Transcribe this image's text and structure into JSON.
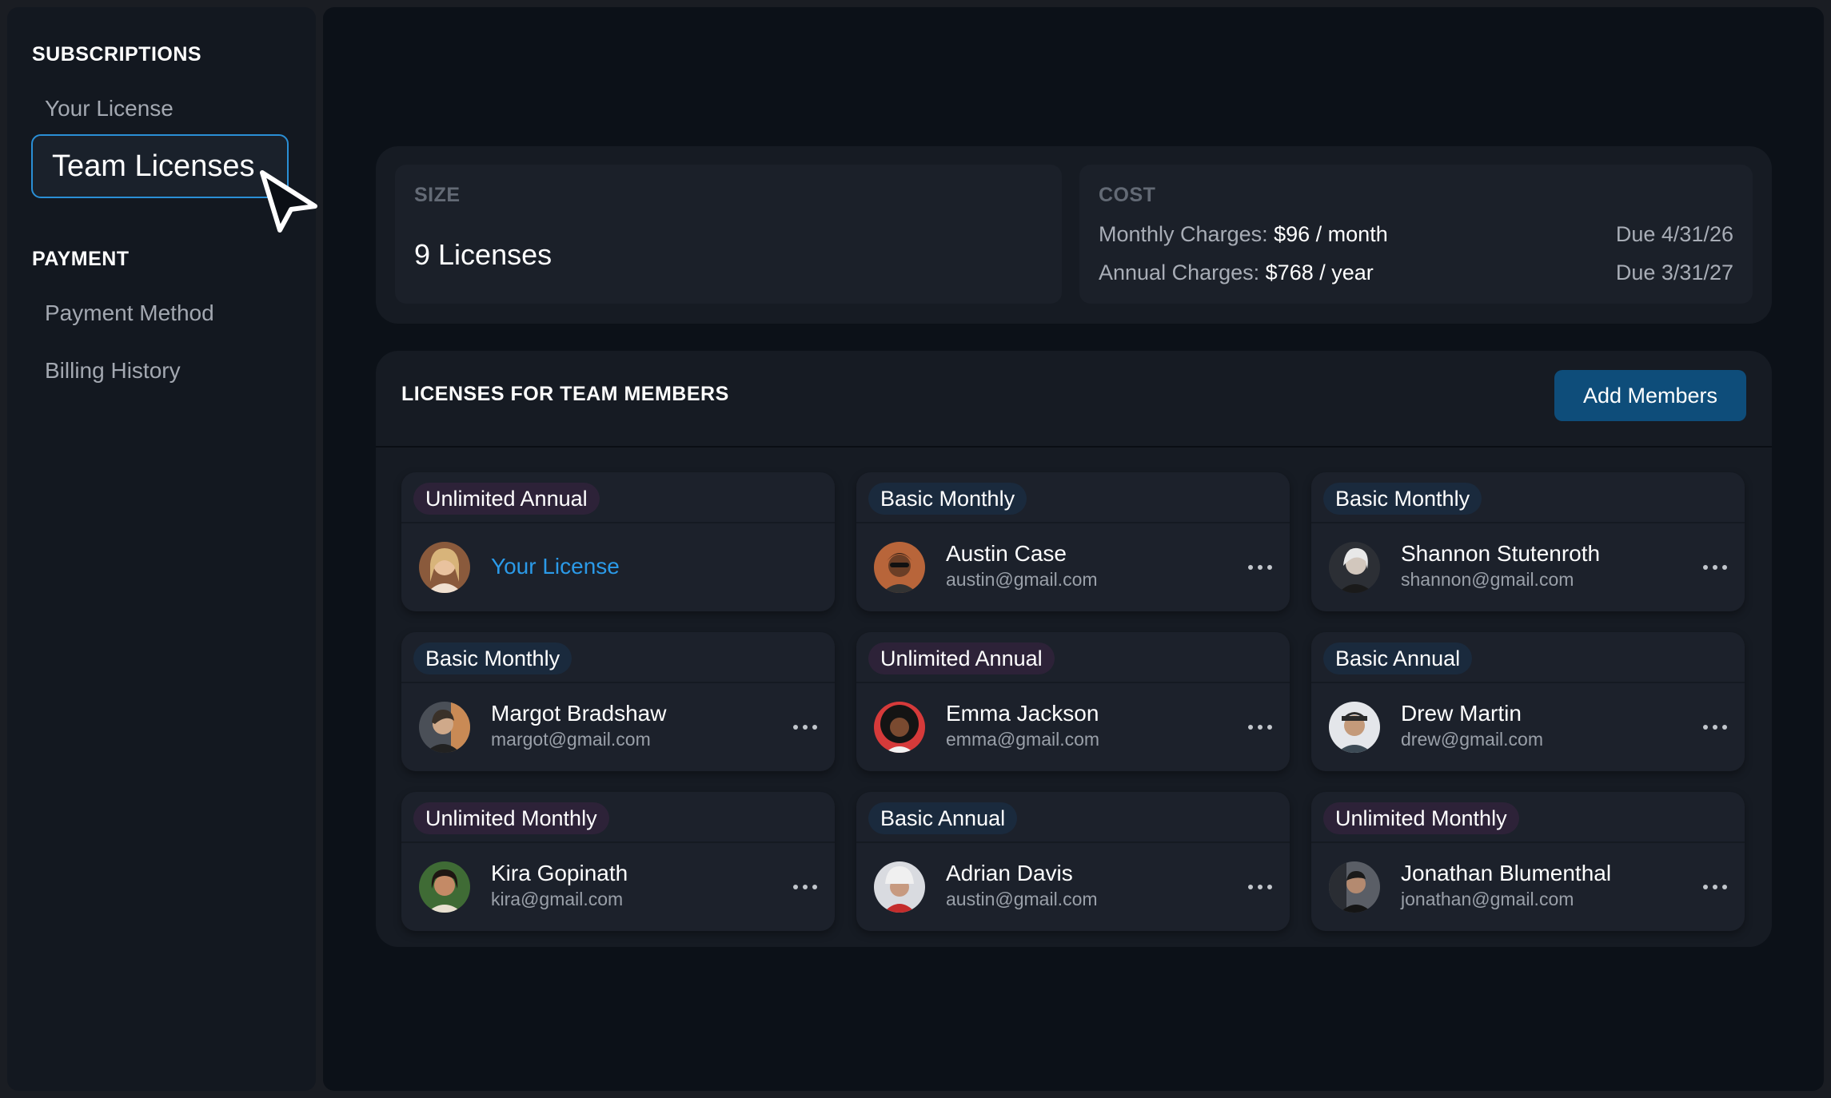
{
  "sidebar": {
    "subscriptions_heading": "SUBSCRIPTIONS",
    "your_license": "Your License",
    "team_licenses": "Team Licenses",
    "payment_heading": "PAYMENT",
    "payment_method": "Payment Method",
    "billing_history": "Billing History"
  },
  "summary": {
    "size_label": "SIZE",
    "size_value": "9 Licenses",
    "cost_label": "COST",
    "monthly_label": "Monthly Charges:",
    "monthly_amount": "$96 / month",
    "monthly_due": "Due 4/31/26",
    "annual_label": "Annual Charges:",
    "annual_amount": "$768 / year",
    "annual_due": "Due 3/31/27"
  },
  "members": {
    "title": "LICENSES FOR TEAM MEMBERS",
    "add_button": "Add Members",
    "cards": [
      {
        "plan": "Unlimited Annual",
        "kind": "unl",
        "name": "",
        "email": "",
        "link": "Your License"
      },
      {
        "plan": "Basic Monthly",
        "kind": "bas",
        "name": "Austin Case",
        "email": "austin@gmail.com"
      },
      {
        "plan": "Basic Monthly",
        "kind": "bas",
        "name": "Shannon Stutenroth",
        "email": "shannon@gmail.com"
      },
      {
        "plan": "Basic Monthly",
        "kind": "bas",
        "name": "Margot Bradshaw",
        "email": "margot@gmail.com"
      },
      {
        "plan": "Unlimited Annual",
        "kind": "unl",
        "name": "Emma Jackson",
        "email": "emma@gmail.com"
      },
      {
        "plan": "Basic Annual",
        "kind": "bas",
        "name": "Drew Martin",
        "email": "drew@gmail.com"
      },
      {
        "plan": "Unlimited Monthly",
        "kind": "unl",
        "name": "Kira Gopinath",
        "email": "kira@gmail.com"
      },
      {
        "plan": "Basic Annual",
        "kind": "bas",
        "name": "Adrian Davis",
        "email": "austin@gmail.com"
      },
      {
        "plan": "Unlimited Monthly",
        "kind": "unl",
        "name": "Jonathan Blumenthal",
        "email": "jonathan@gmail.com"
      }
    ]
  },
  "colors": {
    "accent": "#2a8fd6",
    "link": "#2b9ae8",
    "button": "#0e4d7a",
    "unlimited_badge": "#2d2238",
    "basic_badge": "#1a2a3d"
  },
  "icons": [
    "mouse-pointer-icon",
    "more-horizontal-icon",
    "avatar-photo"
  ]
}
